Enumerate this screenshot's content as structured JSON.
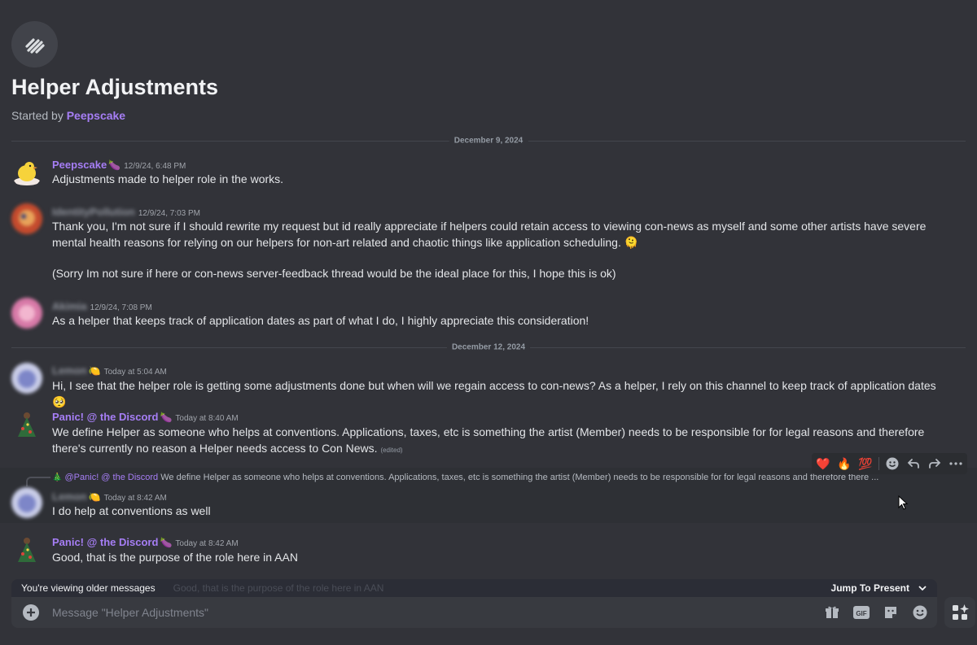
{
  "thread": {
    "title": "Helper Adjustments",
    "started_by_prefix": "Started by ",
    "started_by_name": "Peepscake",
    "icon": "thread-icon"
  },
  "dividers": [
    "December 9, 2024",
    "December 12, 2024"
  ],
  "messages": [
    {
      "user": "Peepscake",
      "badge": "🍆",
      "time": "12/9/24, 6:48 PM",
      "text": "Adjustments made to helper role in the works."
    },
    {
      "user": "IdentityPollution",
      "time": "12/9/24, 7:03 PM",
      "text": "Thank you, I'm not sure if I should rewrite my request but id really appreciate if helpers could retain access to viewing con-news as myself and some other artists have severe mental health reasons for relying on our helpers for non-art related and chaotic things like application scheduling. 🫠",
      "text2": "(Sorry Im not sure if here or  con-news server-feedback thread would be the ideal place for this, I hope this is ok)"
    },
    {
      "user": "Akimia",
      "time": "12/9/24, 7:08 PM",
      "text": "As a helper that keeps track of application dates as part of what I do, I highly appreciate this consideration!"
    },
    {
      "user": "Lemon",
      "badge": "🍋",
      "time": "Today at 5:04 AM",
      "text": "Hi, I see that the helper role is getting some adjustments done but when will we regain access to con-news? As a helper, I rely on this channel to keep track of application dates🥺"
    },
    {
      "user": "Panic! @ the Discord",
      "badge": "🍆",
      "time": "Today at 8:40 AM",
      "text": "We define Helper as someone who helps at conventions. Applications, taxes, etc is something the artist (Member) needs to be responsible for for legal reasons and therefore there's currently no reason a Helper needs access to Con News.",
      "edited": "(edited)"
    },
    {
      "user": "Lemon",
      "badge": "🍋",
      "time": "Today at 8:42 AM",
      "reply_name": "@Panic! @ the Discord",
      "reply_text": "We define Helper as someone who helps at conventions. Applications, taxes, etc is something the artist (Member) needs to be responsible for for legal reasons and therefore there ...",
      "text": "I do help at conventions as well"
    },
    {
      "user": "Panic! @ the Discord",
      "badge": "🍆",
      "time": "Today at 8:42 AM",
      "text": "Good, that is the purpose of the role here in AAN"
    }
  ],
  "reactions": [
    "❤️",
    "🔥",
    "💯"
  ],
  "older_bar": {
    "label": "You're viewing older messages",
    "ghost": "Good, that is the purpose of the role here in AAN",
    "jump": "Jump To Present"
  },
  "composer": {
    "placeholder": "Message \"Helper Adjustments\"",
    "gif_label": "GIF"
  },
  "colors": {
    "background": "#323339",
    "accent_name": "#a67ef5",
    "composer": "#383a40"
  }
}
